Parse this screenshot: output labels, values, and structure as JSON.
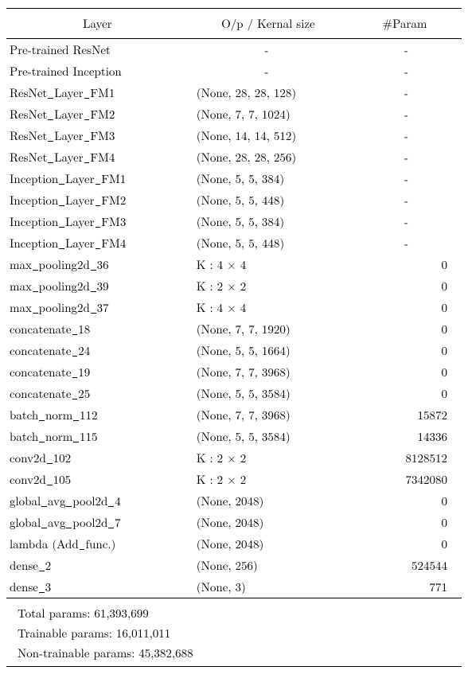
{
  "header": {
    "layer": "Layer",
    "size": "O/p / Kernal size",
    "param": "#Param"
  },
  "rows": [
    {
      "layer_raw": "Pre-trained ResNet",
      "size": "-",
      "size_center": true,
      "param": "-",
      "param_center": true
    },
    {
      "layer_raw": "Pre-trained Inception",
      "size": "-",
      "size_center": true,
      "param": "-",
      "param_center": true
    },
    {
      "layer_raw": "ResNet_Layer_FM1",
      "size": "(None, 28, 28, 128)",
      "param": "-",
      "param_center": true
    },
    {
      "layer_raw": "ResNet_Layer_FM2",
      "size": "(None, 7, 7, 1024)",
      "param": "-",
      "param_center": true
    },
    {
      "layer_raw": "ResNet_Layer_FM3",
      "size": "(None, 14, 14, 512)",
      "param": "-",
      "param_center": true
    },
    {
      "layer_raw": "ResNet_Layer_FM4",
      "size": "(None, 28, 28, 256)",
      "param": "-",
      "param_center": true
    },
    {
      "layer_raw": "Inception_Layer_FM1",
      "size": "(None, 5, 5, 384)",
      "param": "-",
      "param_center": true
    },
    {
      "layer_raw": "Inception_Layer_FM2",
      "size": "(None, 5, 5, 448)",
      "param": "-",
      "param_center": true
    },
    {
      "layer_raw": "Inception_Layer_FM3",
      "size": "(None, 5, 5, 384)",
      "param": "-",
      "param_center": true
    },
    {
      "layer_raw": "Inception_Layer_FM4",
      "size": "(None, 5, 5, 448)",
      "param": "-",
      "param_center": true
    },
    {
      "layer_raw": "max_pooling2d_36",
      "size_html": "K : 4 × 4",
      "param": "0"
    },
    {
      "layer_raw": "max_pooling2d_39",
      "size_html": "K : 2 × 2",
      "param": "0"
    },
    {
      "layer_raw": "max_pooling2d_37",
      "size_html": "K : 4 × 4",
      "param": "0"
    },
    {
      "layer_raw": "concatenate_18",
      "size": "(None, 7, 7, 1920)",
      "param": "0"
    },
    {
      "layer_raw": "concatenate_24",
      "size": "(None, 5, 5, 1664)",
      "param": "0"
    },
    {
      "layer_raw": "concatenate_19",
      "size": "(None, 7, 7, 3968)",
      "param": "0"
    },
    {
      "layer_raw": "concatenate_25",
      "size": "(None, 5, 5, 3584)",
      "param": "0"
    },
    {
      "layer_raw": "batch_norm_112",
      "size": "(None, 7, 7, 3968)",
      "param": "15872"
    },
    {
      "layer_raw": "batch_norm_115",
      "size": "(None, 5, 5, 3584)",
      "param": "14336"
    },
    {
      "layer_raw": "conv2d_102",
      "size_html": "K : 2 × 2",
      "param": "8128512"
    },
    {
      "layer_raw": "conv2d_105",
      "size_html": "K : 2 × 2",
      "param": "7342080"
    },
    {
      "layer_raw": "global_avg_pool2d_4",
      "size": "(None, 2048)",
      "param": "0"
    },
    {
      "layer_raw": "global_avg_pool2d_7",
      "size": "(None, 2048)",
      "param": "0"
    },
    {
      "layer_raw": "lambda (Add_func.)",
      "size": "(None, 2048)",
      "param": "0"
    },
    {
      "layer_raw": "dense_2",
      "size": "(None, 256)",
      "param": "524544"
    },
    {
      "layer_raw": "dense_3",
      "size": "(None, 3)",
      "param": "771"
    }
  ],
  "summary": [
    "Total params: 61,393,699",
    "Trainable params: 16,011,011",
    "Non-trainable params: 45,382,688"
  ]
}
